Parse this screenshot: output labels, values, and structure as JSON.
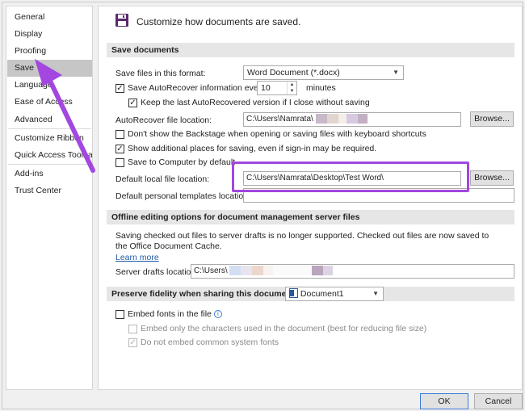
{
  "sidebar": {
    "items": [
      {
        "label": "General"
      },
      {
        "label": "Display"
      },
      {
        "label": "Proofing"
      },
      {
        "label": "Save"
      },
      {
        "label": "Language"
      },
      {
        "label": "Ease of Access"
      },
      {
        "label": "Advanced"
      },
      {
        "label": "Customize Ribbon"
      },
      {
        "label": "Quick Access Toolbar"
      },
      {
        "label": "Add-ins"
      },
      {
        "label": "Trust Center"
      }
    ],
    "selected": "Save"
  },
  "header": {
    "title": "Customize how documents are saved."
  },
  "save_documents": {
    "section_title": "Save documents",
    "format_label": "Save files in this format:",
    "format_value": "Word Document (*.docx)",
    "autorecover_label": "Save AutoRecover information every",
    "autorecover_minutes": "10",
    "minutes_label": "minutes",
    "keep_last_label": "Keep the last AutoRecovered version if I close without saving",
    "autorecover_location_label": "AutoRecover file location:",
    "autorecover_location_value": "C:\\Users\\Namrata\\",
    "browse_label": "Browse...",
    "dont_show_backstage_label": "Don't show the Backstage when opening or saving files with keyboard shortcuts",
    "show_additional_label": "Show additional places for saving, even if sign-in may be required.",
    "save_to_computer_label": "Save to Computer by default",
    "default_local_label": "Default local file location:",
    "default_local_value": "C:\\Users\\Namrata\\Desktop\\Test Word\\",
    "default_templates_label": "Default personal templates location:",
    "default_templates_value": ""
  },
  "offline": {
    "section_title": "Offline editing options for document management server files",
    "description": "Saving checked out files to server drafts is no longer supported. Checked out files are now saved to the Office Document Cache.",
    "learn_more": "Learn more",
    "server_drafts_label": "Server drafts location:",
    "server_drafts_value": "C:\\Users\\"
  },
  "fidelity": {
    "section_title": "Preserve fidelity when sharing this document:",
    "document_value": "Document1",
    "embed_fonts_label": "Embed fonts in the file",
    "embed_only_label": "Embed only the characters used in the document (best for reducing file size)",
    "do_not_embed_label": "Do not embed common system fonts"
  },
  "footer": {
    "ok_label": "OK",
    "cancel_label": "Cancel"
  },
  "colors": {
    "highlight": "#a347e0",
    "arrow": "#a347e0",
    "selected_bg": "#c6c6c6"
  }
}
